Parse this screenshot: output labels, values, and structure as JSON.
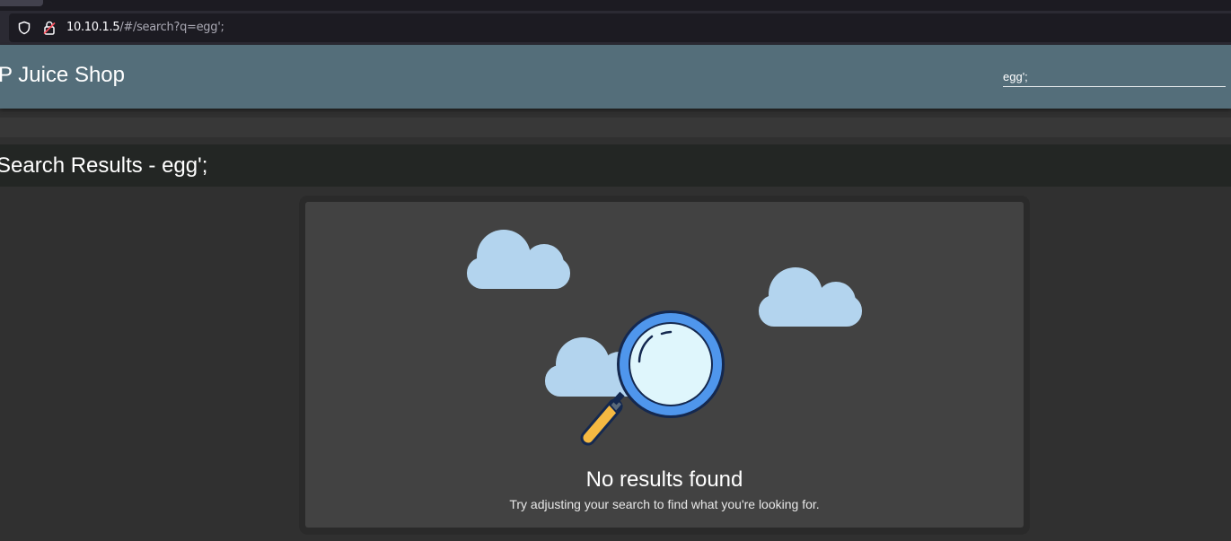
{
  "browser": {
    "url_host": "10.10.1.5",
    "url_path": "/#/search?q=egg';"
  },
  "app": {
    "title": "P Juice Shop",
    "search_value": "egg';"
  },
  "results": {
    "title": "Search Results - egg';",
    "empty_title": "No results found",
    "empty_subtitle": "Try adjusting your search to find what you're looking for."
  },
  "icons": {
    "shield": "shield-icon",
    "lock": "insecure-lock-icon",
    "illustration": "magnifying-glass-clouds-illustration"
  },
  "colors": {
    "toolbar": "#546e7a",
    "card": "#424242",
    "cloud": "#b3d4ee",
    "lens_ring": "#4f96ec",
    "handle": "#f5b942"
  }
}
